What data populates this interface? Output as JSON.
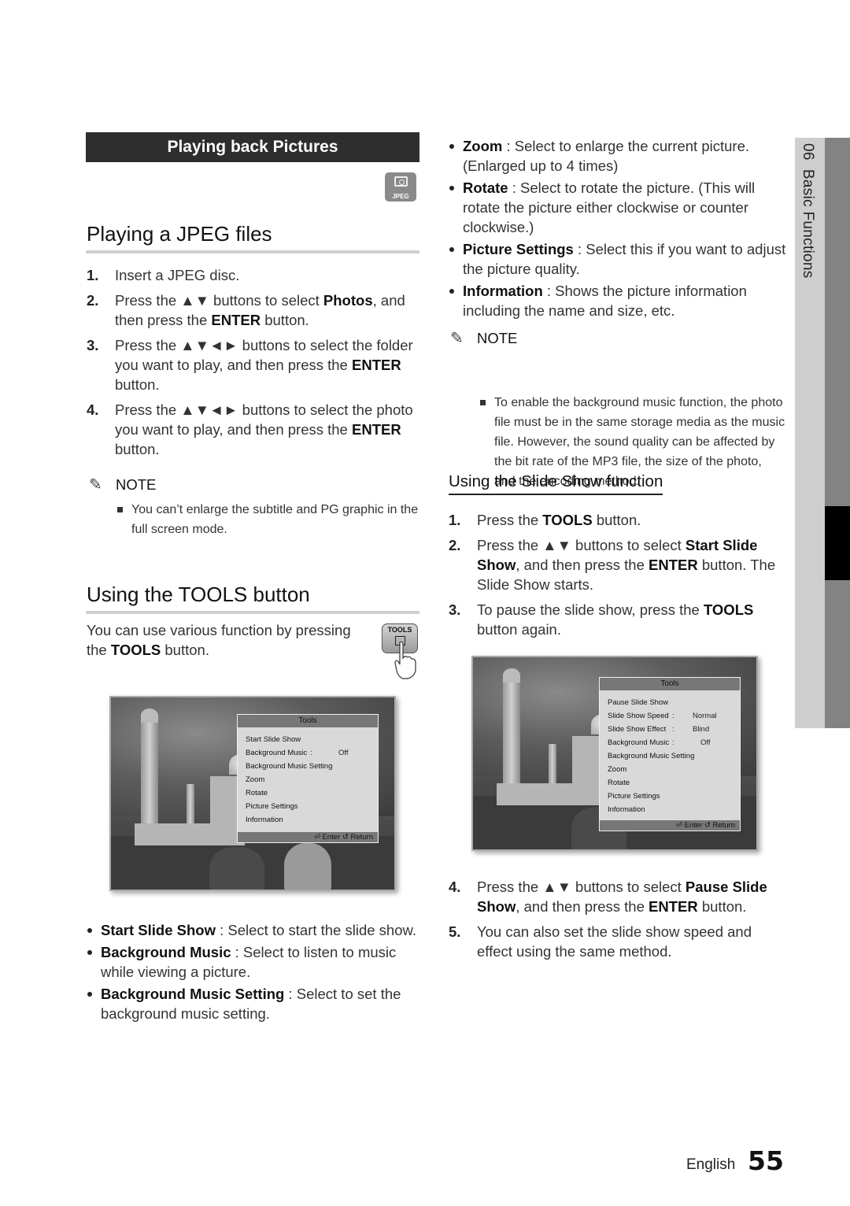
{
  "section_banner": "Playing back Pictures",
  "jpeg_badge": "JPEG",
  "playing_jpeg": {
    "title": "Playing a JPEG files",
    "steps": [
      {
        "num": "1.",
        "parts": [
          {
            "t": "Insert a JPEG disc."
          }
        ]
      },
      {
        "num": "2.",
        "parts": [
          {
            "t": "Press the ▲▼ buttons to select "
          },
          {
            "t": "Photos",
            "b": true
          },
          {
            "t": ", and then press the "
          },
          {
            "t": "ENTER",
            "b": true
          },
          {
            "t": " button."
          }
        ]
      },
      {
        "num": "3.",
        "parts": [
          {
            "t": "Press the ▲▼◄► buttons to select the folder you want to play, and then press the "
          },
          {
            "t": "ENTER",
            "b": true
          },
          {
            "t": " button."
          }
        ]
      },
      {
        "num": "4.",
        "parts": [
          {
            "t": "Press the ▲▼◄► buttons to select the photo you want to play, and then press the "
          },
          {
            "t": "ENTER",
            "b": true
          },
          {
            "t": " button."
          }
        ]
      }
    ],
    "note_label": "NOTE",
    "note": "You can’t enlarge the subtitle and PG graphic in the full screen mode."
  },
  "tools_section": {
    "title": "Using the TOOLS button",
    "intro_parts": [
      {
        "t": "You can use various function by pressing the "
      },
      {
        "t": "TOOLS",
        "b": true
      },
      {
        "t": " button."
      }
    ],
    "tools_button_label": "TOOLS",
    "osd1": {
      "title": "Tools",
      "rows": [
        {
          "label": "Start Slide Show",
          "value": ""
        },
        {
          "label": "Background Music",
          "value": "Off"
        },
        {
          "label": "Background Music Setting",
          "value": ""
        },
        {
          "label": "Zoom",
          "value": ""
        },
        {
          "label": "Rotate",
          "value": ""
        },
        {
          "label": "Picture Settings",
          "value": ""
        },
        {
          "label": "Information",
          "value": ""
        }
      ],
      "footer_enter": "Enter",
      "footer_return": "Return"
    },
    "bullets": [
      {
        "term": "Start Slide Show",
        "desc": " : Select to start the slide show."
      },
      {
        "term": "Background Music",
        "desc": " : Select to listen to music while viewing a picture."
      },
      {
        "term": "Background Music Setting",
        "desc": " : Select to set the background music setting."
      }
    ]
  },
  "right_column": {
    "bullets": [
      {
        "term": "Zoom",
        "desc": " : Select to enlarge the current picture. (Enlarged up to 4 times)"
      },
      {
        "term": "Rotate",
        "desc": " : Select to rotate the picture. (This will rotate the picture either clockwise or counter clockwise.)"
      },
      {
        "term": "Picture Settings",
        "desc": " : Select this if you want to adjust the picture quality."
      },
      {
        "term": "Information",
        "desc": " : Shows the picture information including the name and size, etc."
      }
    ],
    "note_label": "NOTE",
    "note": "To enable the background music function, the photo file must be in the same storage media as the music file. However, the sound quality can be affected by the bit rate of the MP3 file, the size of the photo, and the encoding method.",
    "slideshow": {
      "title": "Using the Slide Show function",
      "steps_a": [
        {
          "num": "1.",
          "parts": [
            {
              "t": "Press the "
            },
            {
              "t": "TOOLS",
              "b": true
            },
            {
              "t": " button."
            }
          ]
        },
        {
          "num": "2.",
          "parts": [
            {
              "t": "Press the ▲▼ buttons to select "
            },
            {
              "t": "Start Slide Show",
              "b": true
            },
            {
              "t": ", and then press the "
            },
            {
              "t": "ENTER",
              "b": true
            },
            {
              "t": " button. The Slide Show starts."
            }
          ]
        },
        {
          "num": "3.",
          "parts": [
            {
              "t": "To pause the slide show, press the "
            },
            {
              "t": "TOOLS",
              "b": true
            },
            {
              "t": " button again."
            }
          ]
        }
      ],
      "osd2": {
        "title": "Tools",
        "rows": [
          {
            "label": "Pause Slide Show",
            "value": ""
          },
          {
            "label": "Slide Show Speed",
            "value": "Normal"
          },
          {
            "label": "Slide Show Effect",
            "value": "Blind"
          },
          {
            "label": "Background Music",
            "value": "Off"
          },
          {
            "label": "Background Music Setting",
            "value": ""
          },
          {
            "label": "Zoom",
            "value": ""
          },
          {
            "label": "Rotate",
            "value": ""
          },
          {
            "label": "Picture Settings",
            "value": ""
          },
          {
            "label": "Information",
            "value": ""
          }
        ],
        "footer_enter": "Enter",
        "footer_return": "Return"
      },
      "steps_b": [
        {
          "num": "4.",
          "parts": [
            {
              "t": "Press the ▲▼ buttons to select "
            },
            {
              "t": "Pause Slide Show",
              "b": true
            },
            {
              "t": ", and then press the "
            },
            {
              "t": "ENTER",
              "b": true
            },
            {
              "t": " button."
            }
          ]
        },
        {
          "num": "5.",
          "parts": [
            {
              "t": "You can also set the slide show speed and effect using the same method."
            }
          ]
        }
      ]
    }
  },
  "side_tab": {
    "chapter": "06",
    "label": "Basic Functions"
  },
  "footer": {
    "language": "English",
    "page": "55"
  }
}
